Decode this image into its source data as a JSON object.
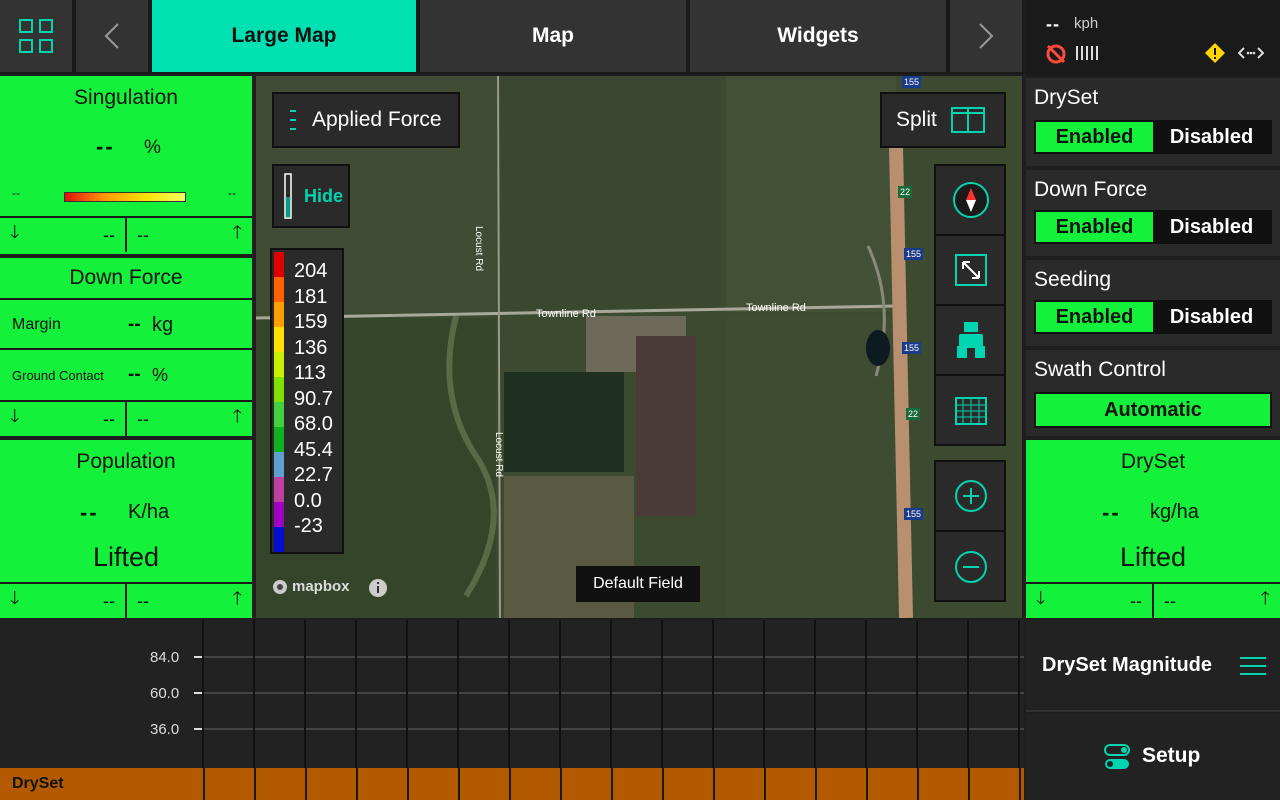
{
  "topbar": {
    "tabs": [
      "Large Map",
      "Map",
      "Widgets"
    ],
    "prev_label": "<",
    "next_label": ">"
  },
  "status": {
    "speed_value": "--",
    "speed_unit": "kph"
  },
  "singulation": {
    "title": "Singulation",
    "value": "--",
    "unit": "%",
    "min_label": "--",
    "max_label": "--",
    "left_value": "--",
    "right_value": "--"
  },
  "downforce_panel": {
    "title": "Down Force",
    "margin_label": "Margin",
    "margin_value": "--",
    "margin_unit": "kg",
    "ground_label": "Ground Contact",
    "ground_value": "--",
    "ground_unit": "%",
    "left_value": "--",
    "right_value": "--"
  },
  "population": {
    "title": "Population",
    "value": "--",
    "unit": "K/ha",
    "state": "Lifted",
    "left_value": "--",
    "right_value": "--"
  },
  "map": {
    "layer_label": "Applied Force",
    "hide_label": "Hide",
    "split_label": "Split",
    "legend": [
      "204",
      "181",
      "159",
      "136",
      "113",
      "90.7",
      "68.0",
      "45.4",
      "22.7",
      "0.0",
      "-23"
    ],
    "legend_colors": [
      "#e00000",
      "#ff6000",
      "#ffa000",
      "#ffe000",
      "#c8f000",
      "#80e000",
      "#40d040",
      "#10b020",
      "#60a0d0",
      "#c040a0",
      "#a000c0",
      "#0010d0"
    ],
    "field_label": "Default Field",
    "attribution": "mapbox",
    "road_labels": [
      "Townline Rd",
      "Townline Rd",
      "Locust Rd",
      "Locust Rd",
      "155",
      "155",
      "155",
      "155",
      "22",
      "22"
    ]
  },
  "right": {
    "dryset_title": "DrySet",
    "downforce_title": "Down Force",
    "seeding_title": "Seeding",
    "enabled_label": "Enabled",
    "disabled_label": "Disabled",
    "swath_title": "Swath Control",
    "swath_value": "Automatic",
    "dryset_rate_title": "DrySet",
    "dryset_rate_value": "--",
    "dryset_rate_unit": "kg/ha",
    "dryset_rate_state": "Lifted",
    "dryset_left_value": "--",
    "dryset_right_value": "--",
    "magnitude_label": "DrySet Magnitude",
    "setup_label": "Setup"
  },
  "chart": {
    "y_ticks": [
      "84.0",
      "60.0",
      "36.0"
    ],
    "row_label": "DrySet"
  },
  "colors": {
    "accent": "#00e0b0",
    "green": "#13f13a",
    "orange": "#b35a00"
  }
}
